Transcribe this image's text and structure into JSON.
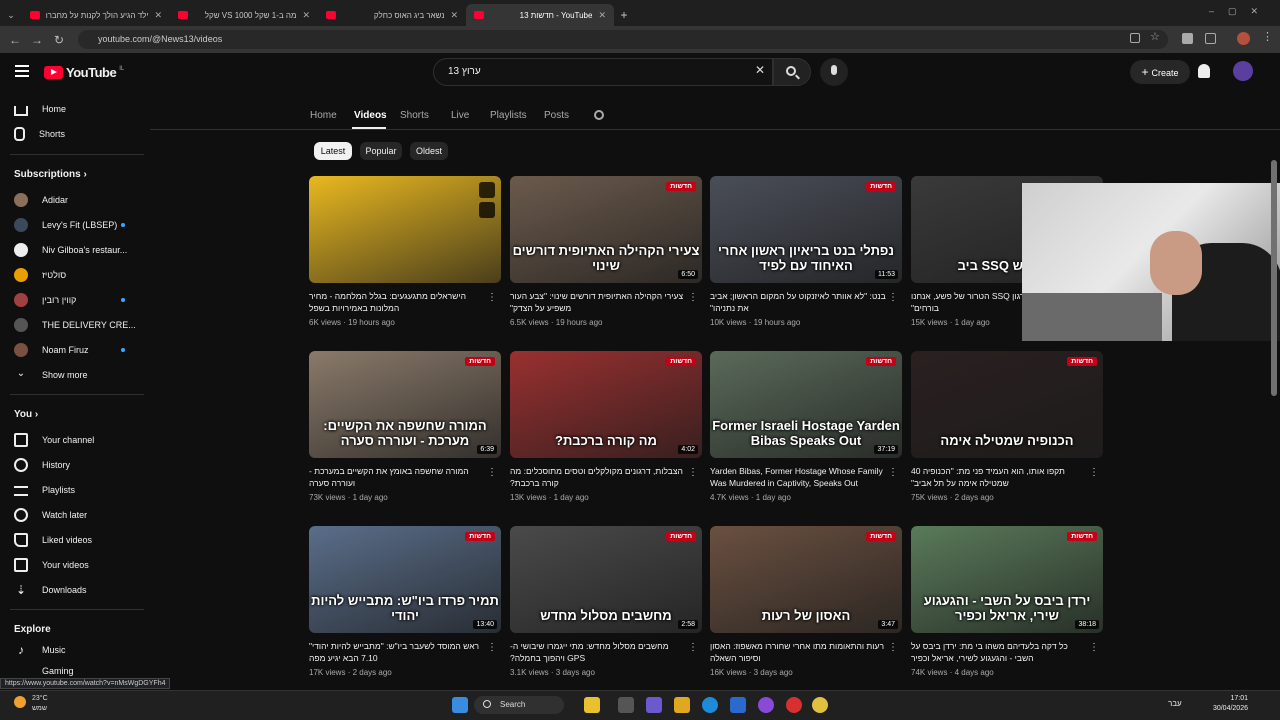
{
  "browser": {
    "tabs": [
      {
        "title": "ילד הגיע הולך לקנות על מחברת הספר",
        "active": false
      },
      {
        "title": "מה ב-1 שקל VS 1000 שקל",
        "active": false
      },
      {
        "title": "נשאר ביג האוס כחלק",
        "active": false
      },
      {
        "title": "YouTube - חדשות 13",
        "active": true
      }
    ],
    "new_tab_label": "+",
    "url": "youtube.com/@News13/videos"
  },
  "youtube": {
    "logo_text": "YouTube",
    "logo_region": "IL",
    "search_value": "ערוץ 13",
    "create_label": "Create"
  },
  "sidebar": {
    "main": [
      {
        "label": "Home",
        "icon": "home-icon"
      },
      {
        "label": "Shorts",
        "icon": "shorts-icon"
      }
    ],
    "subscriptions_heading": "Subscriptions",
    "subscriptions": [
      {
        "label": "Adidar",
        "color": "#8a6f5a",
        "dot": false
      },
      {
        "label": "Levy's Fit (LBSEP)",
        "color": "#3a4a5a",
        "dot": true
      },
      {
        "label": "Niv Gilboa's restaur...",
        "color": "#eeeeee",
        "dot": false
      },
      {
        "label": "סולטיז",
        "color": "#e8a000",
        "dot": false
      },
      {
        "label": "קווין רובין",
        "color": "#a04040",
        "dot": true
      },
      {
        "label": "THE DELIVERY CRE...",
        "color": "#555555",
        "dot": false
      },
      {
        "label": "Noam Firuz",
        "color": "#7a5040",
        "dot": true
      }
    ],
    "show_more": "Show more",
    "you_heading": "You",
    "you": [
      {
        "label": "Your channel",
        "icon": "your-channel-icon"
      },
      {
        "label": "History",
        "icon": "history-icon"
      },
      {
        "label": "Playlists",
        "icon": "playlists-icon"
      },
      {
        "label": "Watch later",
        "icon": "watch-later-icon"
      },
      {
        "label": "Liked videos",
        "icon": "liked-videos-icon"
      },
      {
        "label": "Your videos",
        "icon": "your-videos-icon"
      },
      {
        "label": "Downloads",
        "icon": "downloads-icon"
      }
    ],
    "explore_heading": "Explore",
    "explore": [
      {
        "label": "Music",
        "icon": "music-icon"
      },
      {
        "label": "Gaming",
        "icon": "gaming-icon"
      }
    ]
  },
  "channel_tabs": [
    "Home",
    "Videos",
    "Shorts",
    "Live",
    "Playlists",
    "Posts"
  ],
  "active_channel_tab": "Videos",
  "filter_chips": [
    "Latest",
    "Popular",
    "Oldest"
  ],
  "active_chip": "Latest",
  "videos": [
    {
      "caption": "",
      "duration": "",
      "title": "הישראלים מתגעגעים: בגלל המלחמה - מחיר המלונות באמירויות בשפל",
      "views": "6K views",
      "age": "19 hours ago",
      "bg": "#e9b820",
      "brand": false
    },
    {
      "caption": "צעירי הקהילה האתיופית דורשים שינוי",
      "duration": "6:50",
      "title": "צעירי הקהילה האתיופית דורשים שינוי: \"צבע העור משפיע על הצדק\"",
      "views": "6.5K views",
      "age": "19 hours ago",
      "bg": "#6b5a4c",
      "brand": true
    },
    {
      "caption": "נפתלי בנט בריאיון ראשון אחרי האיחוד עם לפיד",
      "duration": "11:53",
      "title": "בנט: \"לא אוותר לאיזנקוט על המקום הראשון; אביב את נתניהו\"",
      "views": "10K views",
      "age": "19 hours ago",
      "bg": "#4a4e58",
      "brand": true
    },
    {
      "caption": "והייאוש SSQ ביב",
      "duration": "",
      "title": "אביב: \"הם ארגון SSQ הטרור של פשע, אנחנו בורחים\"",
      "views": "15K views",
      "age": "1 day ago",
      "bg": "#3a3a3a",
      "brand": false
    },
    {
      "caption": "המורה שחשפה את הקשיים: מערכת - ועוררה סערה",
      "duration": "6:39",
      "title": "המורה שחשפה באומץ את הקשיים במערכת - ועוררה סערה",
      "views": "73K views",
      "age": "1 day ago",
      "bg": "#8a7a6a",
      "brand": true
    },
    {
      "caption": "מה קורה ברכבת?",
      "duration": "4:02",
      "title": "הצבלות, דרגונים מקולקלים וטסים מתוסכלים: מה קורה ברכבת?",
      "views": "13K views",
      "age": "1 day ago",
      "bg": "#9a3030",
      "brand": true
    },
    {
      "caption": "Former Israeli Hostage Yarden Bibas Speaks Out",
      "duration": "37:19",
      "title": "Yarden Bibas, Former Hostage Whose Family Was Murdered in Captivity, Speaks Out",
      "views": "4.7K views",
      "age": "1 day ago",
      "bg": "#5a6a5a",
      "brand": true
    },
    {
      "caption": "הכנופיה שמטילה אימה",
      "duration": "",
      "title": "תקפו אותו, הוא העמיד פני מת: \"הכנופיה 40 שמטילה אימה על תל אביב\"",
      "views": "75K views",
      "age": "2 days ago",
      "bg": "#2a2020",
      "brand": true
    },
    {
      "caption": "תמיר פרדו ביו\"ש: מתבייש להיות יהודי",
      "duration": "13:40",
      "title": "ראש המוסד לשעבר ביו\"ש: \"מתבייש להיות יהודי\" 7.10 הבא יגיע מפה",
      "views": "17K views",
      "age": "2 days ago",
      "bg": "#5a6e8a",
      "brand": true
    },
    {
      "caption": "מחשבים מסלול מחדש",
      "duration": "2:58",
      "title": "מחשבים מסלול מחדש: מתי ייגמרו שיבושי ה-GPS ויהפוך בחמלה?",
      "views": "3.1K views",
      "age": "3 days ago",
      "bg": "#4a4a4a",
      "brand": true
    },
    {
      "caption": "האסון של רעות",
      "duration": "3:47",
      "title": "רעות והתאומות מתו אחרי שחוררו מאשפוז: האסון וסיפור השאלה",
      "views": "16K views",
      "age": "3 days ago",
      "bg": "#6a5040",
      "brand": true
    },
    {
      "caption": "ירדן ביבס על השבי - והגעגוע שירי, אריאל וכפיר",
      "duration": "38:18",
      "title": "כל דקה בלעדיהם משהו בי מת: ירדן ביבס על השבי - והגעגוע לשירי, אריאל וכפיר",
      "views": "74K views",
      "age": "4 days ago",
      "bg": "#5a7a5a",
      "brand": true
    }
  ],
  "status_url": "https://www.youtube.com/watch?v=nMsWgDGYFh4",
  "taskbar": {
    "search_label": "Search",
    "weather_temp": "23°C",
    "weather_desc": "שמש",
    "time": "17:01",
    "date": "30/04/2026",
    "lang": "עבר"
  }
}
